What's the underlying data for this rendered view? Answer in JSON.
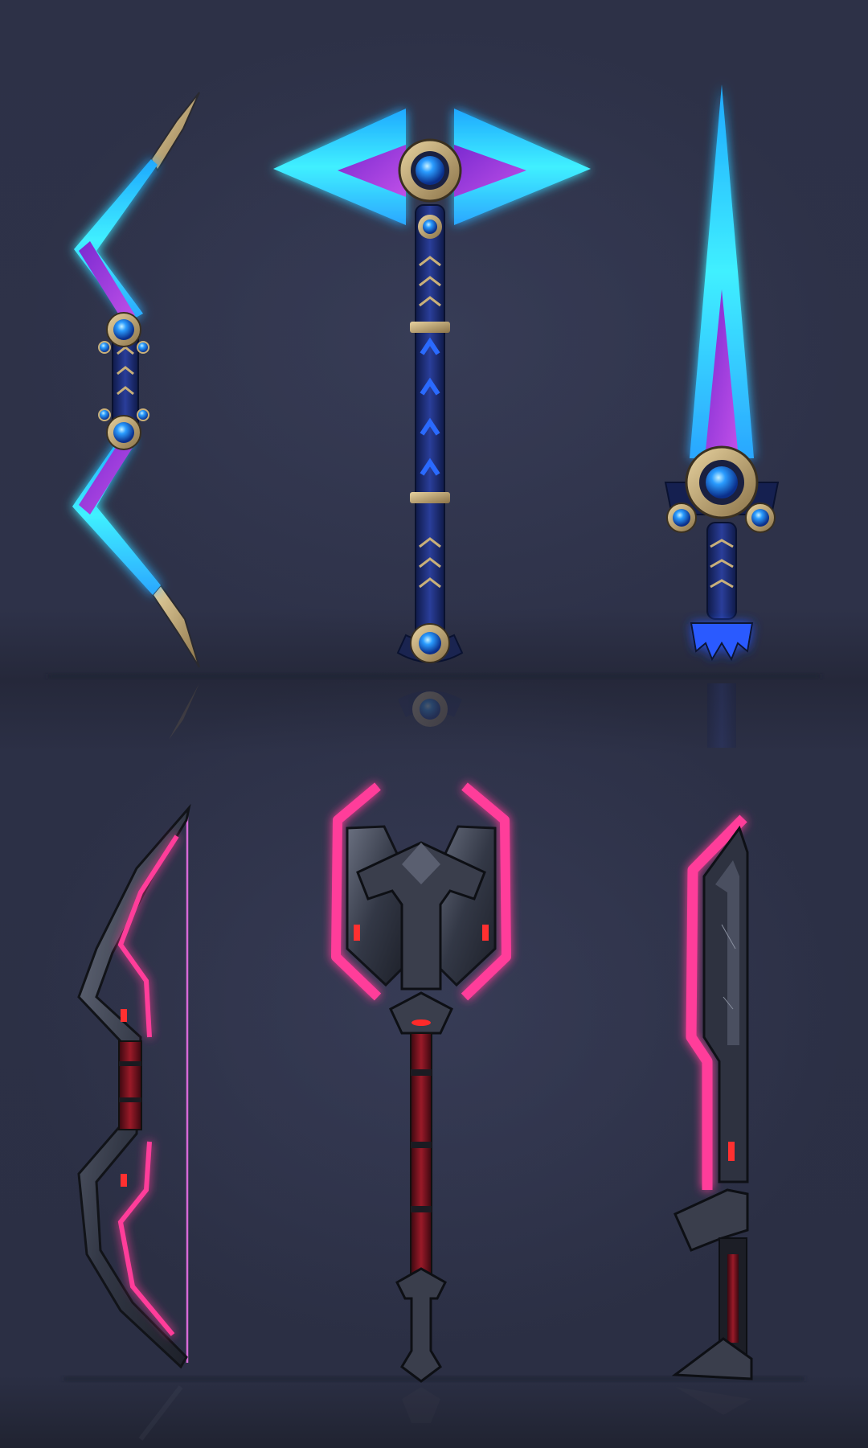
{
  "colors": {
    "background_top": "#2c3045",
    "background_bottom": "#262a3a",
    "floor_line": "#1c1f2c",
    "cyan_glow": "#28e6ff",
    "violet": "#9a3bd8",
    "gem_blue": "#1e8cff",
    "gold_trim": "#c9b07a",
    "navy_handle": "#1a2a6a",
    "pink_neon": "#ff3d9a",
    "dark_metal": "#2a2e3a",
    "blood_red": "#8a1422"
  },
  "weapons": [
    {
      "name": "cyan-crystal-bow",
      "set": "cyan"
    },
    {
      "name": "cyan-crystal-axe",
      "set": "cyan"
    },
    {
      "name": "cyan-crystal-sword",
      "set": "cyan"
    },
    {
      "name": "neon-pink-bow",
      "set": "pink"
    },
    {
      "name": "neon-pink-axe",
      "set": "pink"
    },
    {
      "name": "neon-pink-blade",
      "set": "pink"
    }
  ]
}
